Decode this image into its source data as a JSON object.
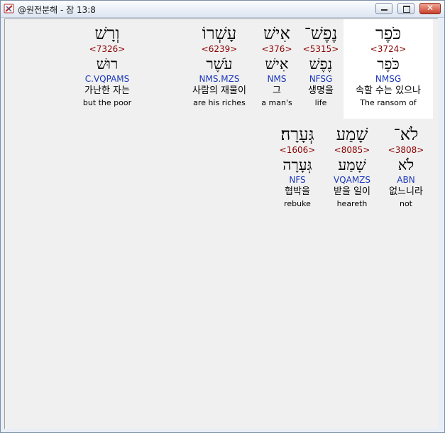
{
  "window": {
    "title": "@원전분해 - 잠 13:8",
    "minimize_glyph": "–",
    "maximize_glyph": "□",
    "close_glyph": "✕"
  },
  "words": [
    {
      "hebrew": "כֹּפֶר",
      "strong": "<3724>",
      "lemma": "כֹּפֶר",
      "morph": "NMSG",
      "korean": "속할 수는 있으나",
      "english": "The ransom of",
      "selected": true
    },
    {
      "hebrew": "נֶפֶשׁ־",
      "strong": "<5315>",
      "lemma": "נֶפֶשׁ",
      "morph": "NFSG",
      "korean": "생명을",
      "english": "life",
      "selected": false
    },
    {
      "hebrew": "אִישׁ",
      "strong": "<376>",
      "lemma": "אִישׁ",
      "morph": "NMS",
      "korean": "그",
      "english": "a man's",
      "selected": false
    },
    {
      "hebrew": "עָשְׁרוֹ",
      "strong": "<6239>",
      "lemma": "עֹשֶׁר",
      "morph": "NMS.MZS",
      "korean": "사람의 재물이",
      "english": "are his riches",
      "selected": false
    },
    {
      "hebrew": "וְרָשׁ",
      "strong": "<7326>",
      "lemma": "רוּשׁ",
      "morph": "C.VQPAMS",
      "korean": "가난한 자는",
      "english": "but the poor",
      "selected": false
    },
    {
      "hebrew": "לֹא־",
      "strong": "<3808>",
      "lemma": "לֹא",
      "morph": "ABN",
      "korean": "없느니라",
      "english": "not",
      "selected": false
    },
    {
      "hebrew": "שָׁמַע",
      "strong": "<8085>",
      "lemma": "שָׁמַע",
      "morph": "VQAMZS",
      "korean": "받을 일이",
      "english": "heareth",
      "selected": false
    },
    {
      "hebrew": "גְּעָרָה׃",
      "strong": "<1606>",
      "lemma": "גְּעָרָה",
      "morph": "NFS",
      "korean": "협박을",
      "english": "rebuke",
      "selected": false
    }
  ]
}
